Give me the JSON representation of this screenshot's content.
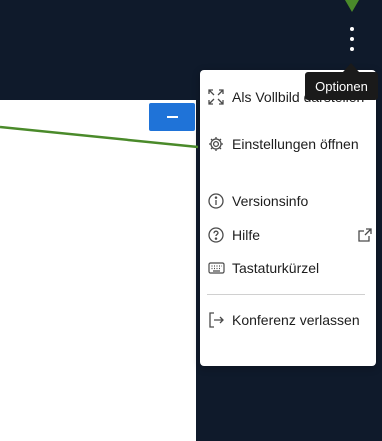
{
  "options_button": {
    "tooltip": "Optionen"
  },
  "colors": {
    "toolbar_bg": "#0f1a2b",
    "accent_blue": "#1f73d8",
    "annotation_green": "#4a8a2a"
  },
  "menu": {
    "items": [
      {
        "icon": "fullscreen-icon",
        "label": "Als Vollbild darstellen"
      },
      {
        "icon": "gear-icon",
        "label": "Einstellungen öffnen"
      },
      {
        "icon": "info-icon",
        "label": "Versionsinfo"
      },
      {
        "icon": "help-icon",
        "label": "Hilfe",
        "trailing_icon": "external-link-icon"
      },
      {
        "icon": "keyboard-icon",
        "label": "Tastaturkürzel"
      },
      {
        "icon": "logout-icon",
        "label": "Konferenz verlassen"
      }
    ]
  }
}
